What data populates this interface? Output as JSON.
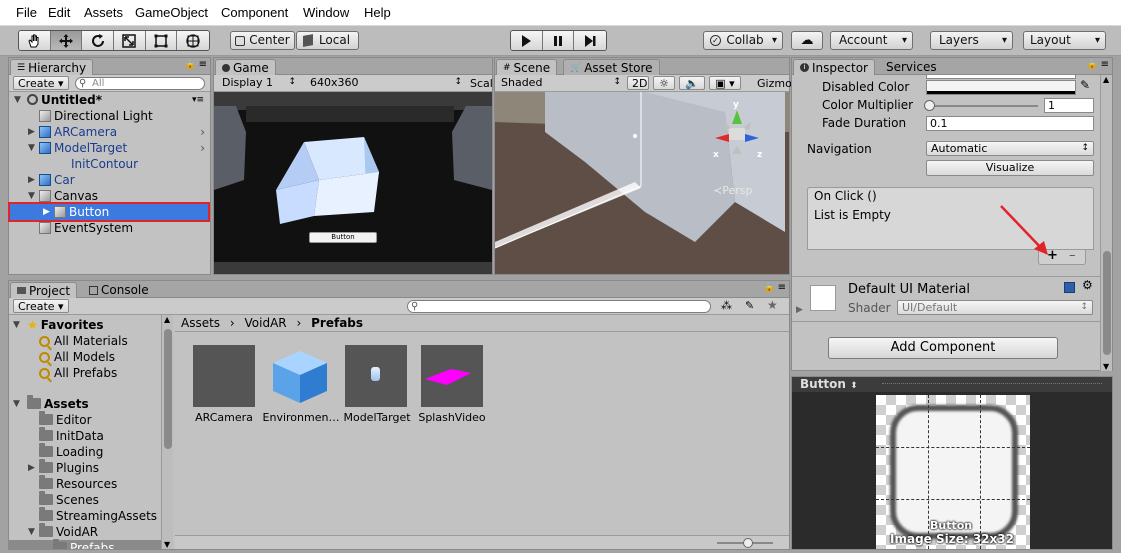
{
  "menu": [
    "File",
    "Edit",
    "Assets",
    "GameObject",
    "Component",
    "Window",
    "Help"
  ],
  "toolbar": {
    "tools": [
      "hand-tool-icon",
      "move-tool-icon",
      "rotate-tool-icon",
      "scale-tool-icon",
      "rect-tool-icon",
      "transform-tool-icon"
    ],
    "pivot": "Center",
    "space": "Local",
    "collab": "Collab",
    "account": "Account",
    "layers": "Layers",
    "layout": "Layout"
  },
  "hierarchy": {
    "tab": "Hierarchy",
    "create": "Create",
    "search_placeholder": "All",
    "scene": "Untitled*",
    "items": [
      {
        "label": "Directional Light",
        "color": "#000000"
      },
      {
        "label": "ARCamera",
        "color": "#1a3c8c"
      },
      {
        "label": "ModelTarget",
        "color": "#1a3c8c"
      },
      {
        "label": "InitContour",
        "color": "#1a3c8c"
      },
      {
        "label": "Car",
        "color": "#1a3c8c"
      },
      {
        "label": "Canvas",
        "color": "#000000"
      },
      {
        "label": "Button",
        "color": "#ffffff"
      },
      {
        "label": "EventSystem",
        "color": "#000000"
      }
    ]
  },
  "game": {
    "tab": "Game",
    "display": "Display 1",
    "resolution": "640x360",
    "scale": "Scal",
    "button_text": "Button"
  },
  "scene": {
    "tab_scene": "Scene",
    "tab_store": "Asset Store",
    "shading": "Shaded",
    "mode2d": "2D",
    "gizmos": "Gizmo",
    "persp": "Persp",
    "axes": {
      "x": "x",
      "z": "z",
      "y": "y"
    }
  },
  "inspector": {
    "tab": "Inspector",
    "tab2": "Services",
    "disabled_color_label": "Disabled Color",
    "color_multiplier_label": "Color Multiplier",
    "color_multiplier_value": "1",
    "fade_duration_label": "Fade Duration",
    "fade_duration_value": "0.1",
    "navigation_label": "Navigation",
    "navigation_value": "Automatic",
    "visualize": "Visualize",
    "onclick_header": "On Click ()",
    "onclick_empty": "List is Empty",
    "plus": "+",
    "minus": "–",
    "material_name": "Default UI Material",
    "shader_label": "Shader",
    "shader_value": "UI/Default",
    "add_component": "Add Component"
  },
  "preview": {
    "title": "Button",
    "caption": "Button",
    "size_text": "Image Size: 32x32"
  },
  "project": {
    "tab": "Project",
    "tab2": "Console",
    "create": "Create",
    "favorites_title": "Favorites",
    "favorites": [
      "All Materials",
      "All Models",
      "All Prefabs"
    ],
    "assets_title": "Assets",
    "folders": [
      "Editor",
      "InitData",
      "Loading",
      "Plugins",
      "Resources",
      "Scenes",
      "StreamingAssets",
      "VoidAR",
      "Prefabs"
    ],
    "breadcrumb": [
      "Assets",
      "VoidAR",
      "Prefabs"
    ],
    "grid": [
      "ARCamera",
      "Environmen…",
      "ModelTarget",
      "SplashVideo"
    ]
  },
  "colors": {
    "selection": "#3d7ae0",
    "annotation": "#e0242a",
    "accent_blue": "#1a3c8c",
    "magenta": "#ff00ff"
  }
}
